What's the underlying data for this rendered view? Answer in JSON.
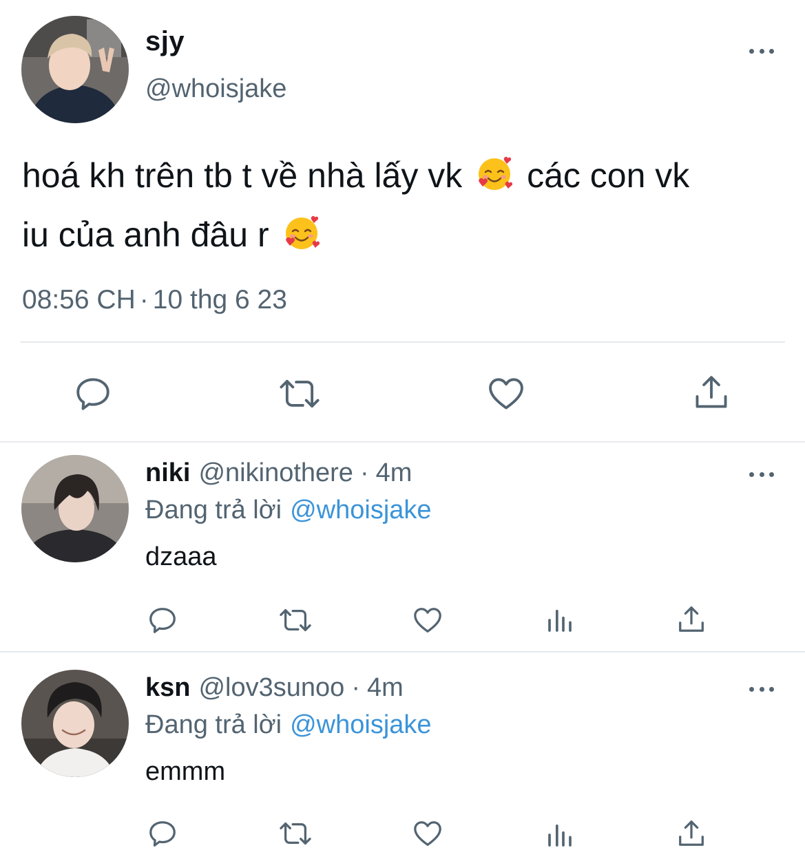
{
  "main_tweet": {
    "display_name": "sjy",
    "handle": "@whoisjake",
    "text_part1": "hoá kh trên tb t về nhà lấy vk",
    "text_part2": "các con vk",
    "text_part3": "iu của anh đâu r",
    "emoji": "smiling-face-with-hearts",
    "time": "08:56 CH",
    "separator": "·",
    "date": "10 thg 6 23"
  },
  "replies": [
    {
      "display_name": "niki",
      "handle": "@nikinothere",
      "separator": "·",
      "age": "4m",
      "replying_label": "Đang trả lời",
      "replying_to": "@whoisjake",
      "text": "dzaaa"
    },
    {
      "display_name": "ksn",
      "handle": "@lov3sunoo",
      "separator": "·",
      "age": "4m",
      "replying_label": "Đang trả lời",
      "replying_to": "@whoisjake",
      "text": "emmm"
    }
  ],
  "icons": {
    "reply": "reply-icon",
    "retweet": "retweet-icon",
    "like": "heart-icon",
    "share": "share-icon",
    "views": "views-icon",
    "more": "more-icon"
  },
  "colors": {
    "text": "#0f1419",
    "secondary": "#536471",
    "link": "#3b94d9",
    "divider": "#e6e9ec"
  }
}
